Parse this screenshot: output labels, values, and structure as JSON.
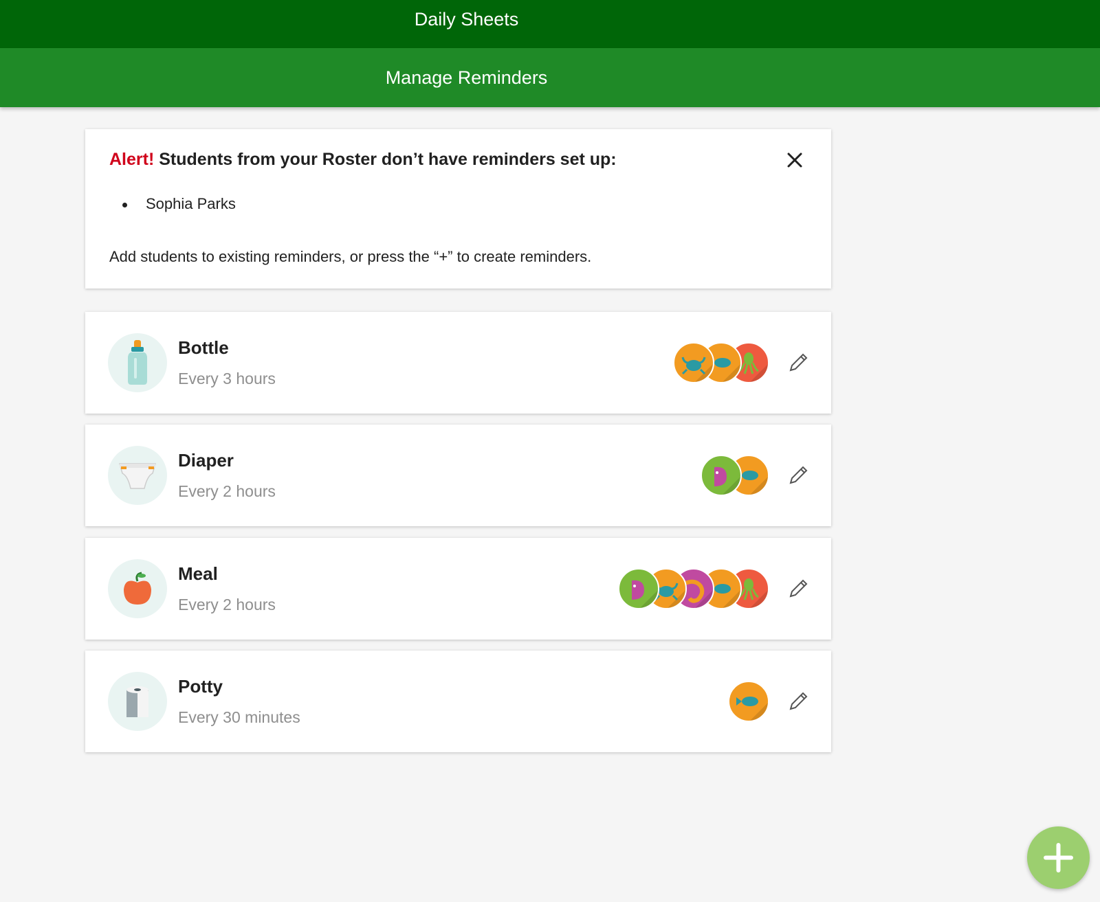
{
  "app": {
    "title": "Daily Sheets"
  },
  "page": {
    "title": "Manage Reminders"
  },
  "alert": {
    "label": "Alert!",
    "message": "Students from your Roster don’t have reminders set up:",
    "students": [
      "Sophia Parks"
    ],
    "note": "Add students to existing reminders, or press the “+” to create reminders.",
    "close_icon": "close-icon"
  },
  "reminders": [
    {
      "name": "Bottle",
      "frequency": "Every 3 hours",
      "icon": "bottle-icon",
      "avatars": [
        "crab",
        "fish",
        "octopus"
      ]
    },
    {
      "name": "Diaper",
      "frequency": "Every 2 hours",
      "icon": "diaper-icon",
      "avatars": [
        "pink-fish",
        "fish"
      ]
    },
    {
      "name": "Meal",
      "frequency": "Every 2 hours",
      "icon": "apple-icon",
      "avatars": [
        "pink-fish",
        "crab",
        "shrimp",
        "fish",
        "octopus"
      ]
    },
    {
      "name": "Potty",
      "frequency": "Every 30 minutes",
      "icon": "toilet-paper-icon",
      "avatars": [
        "fish"
      ]
    }
  ],
  "fab": {
    "icon": "plus-icon"
  },
  "colors": {
    "header_dark": "#006608",
    "header": "#1f8a27",
    "alert": "#d0021b",
    "fab": "#9ccf6f",
    "avatar_orange": "#f29b21",
    "avatar_red": "#ee5a3f",
    "avatar_green": "#7cba3b",
    "avatar_purple": "#c04aa0"
  }
}
